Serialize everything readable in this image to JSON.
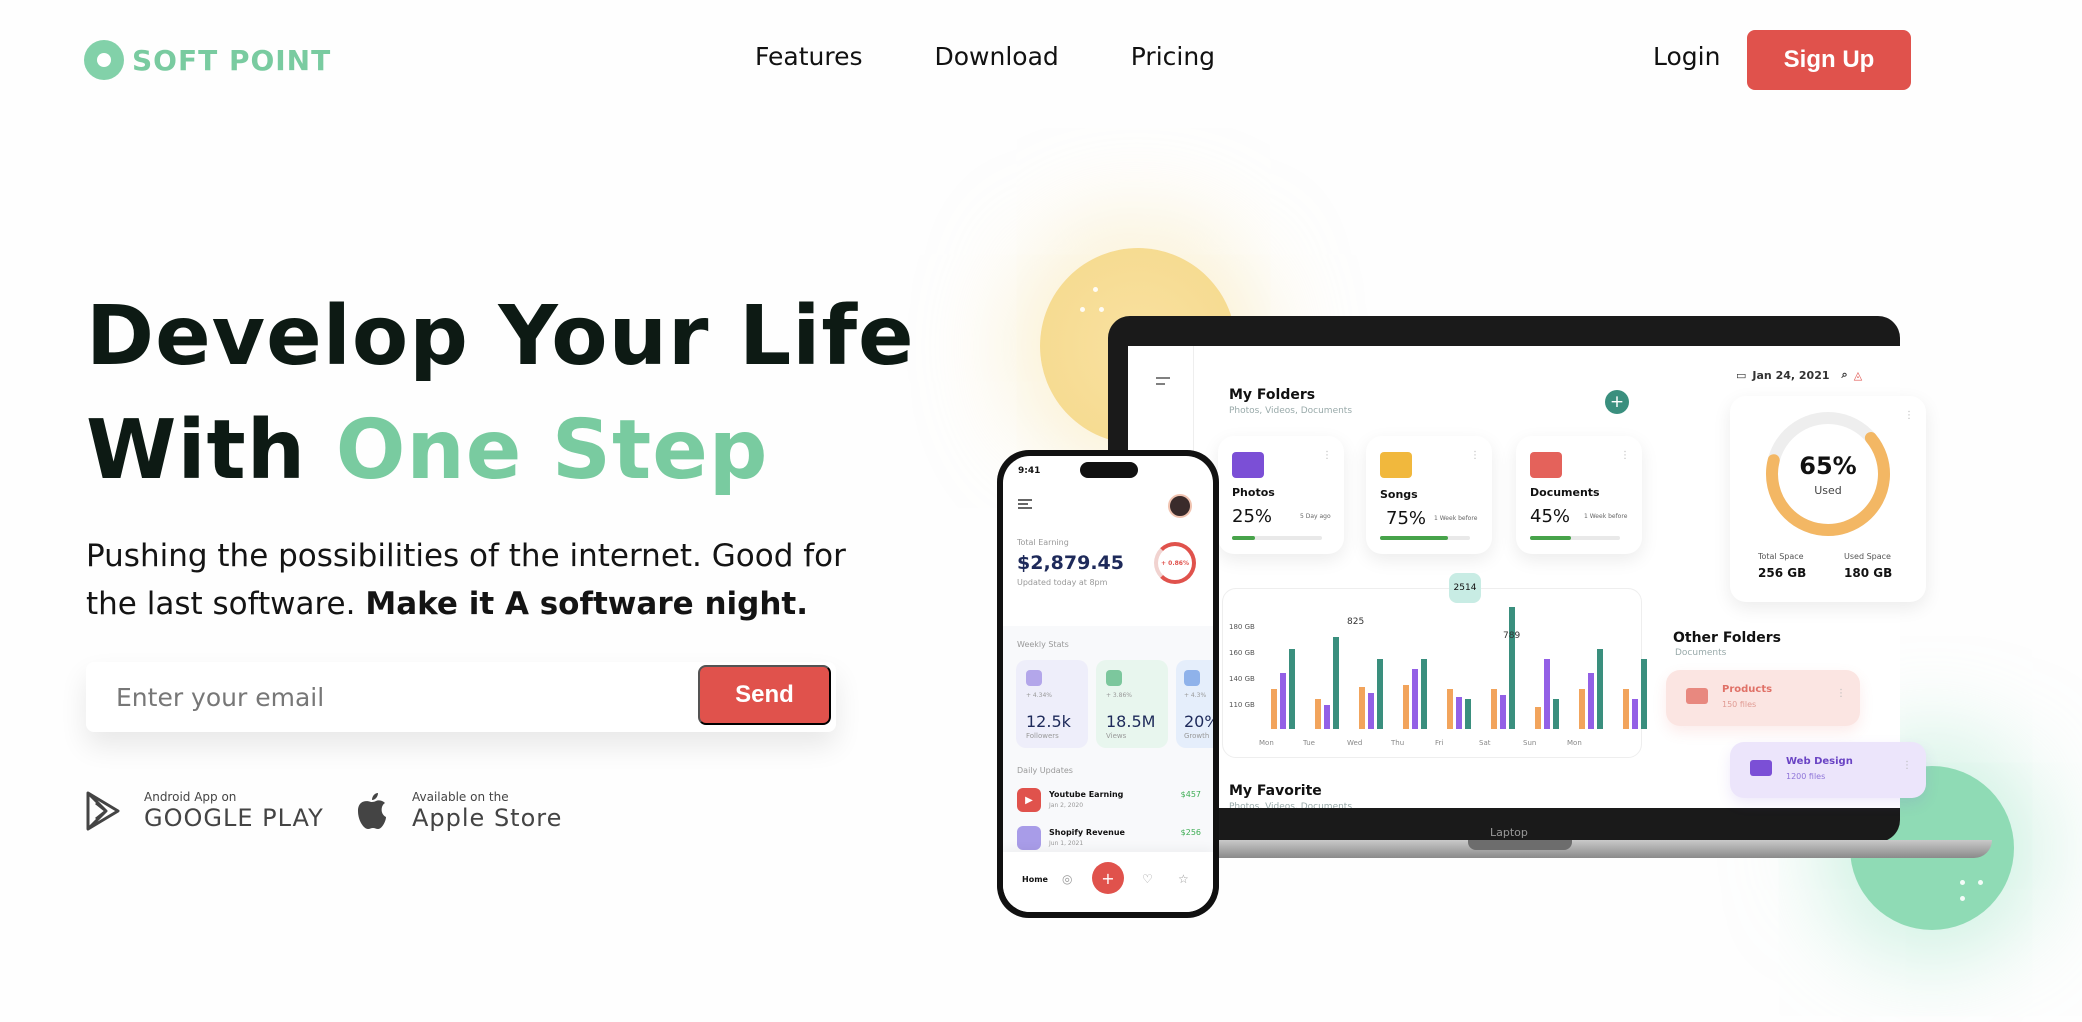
{
  "header": {
    "logo_text": "SOFT POINT",
    "nav": [
      "Features",
      "Download",
      "Pricing"
    ],
    "login_label": "Login",
    "signup_label": "Sign Up"
  },
  "hero": {
    "title_line1": "Develop Your Life",
    "title_line2_plain": "With ",
    "title_line2_accent": "One Step",
    "subtitle_plain": "Pushing the possibilities of the internet. Good for the last software. ",
    "subtitle_bold": "Make it A software night.",
    "email_placeholder": "Enter your email",
    "send_label": "Send"
  },
  "stores": {
    "google": {
      "small": "Android App on",
      "big": "GOOGLE PLAY"
    },
    "apple": {
      "small": "Available on the",
      "big": "Apple Store"
    }
  },
  "laptop": {
    "label": "Laptop",
    "date": "Jan 24, 2021",
    "folders_title": "My Folders",
    "folders_sub": "Photos, Videos, Documents",
    "folders": [
      {
        "name": "Photos",
        "percent": "25%",
        "meta": "5 Day ago",
        "fill": 0.25,
        "color": "#7b4fd6"
      },
      {
        "name": "Songs",
        "percent": "75%",
        "meta": "1 Week before",
        "fill": 0.75,
        "color": "#f1b83d"
      },
      {
        "name": "Documents",
        "percent": "45%",
        "meta": "1 Week before",
        "fill": 0.45,
        "color": "#e4625b"
      }
    ],
    "storage": {
      "percent": "65%",
      "used_label": "Used",
      "total_label": "Total Space",
      "total_value": "256 GB",
      "used_label2": "Used Space",
      "used_value": "180 GB",
      "fill": 0.65
    },
    "chart": {
      "ylabels": [
        "180 GB",
        "160 GB",
        "140 GB",
        "110 GB"
      ],
      "days": [
        "Mon",
        "Tue",
        "Wed",
        "Thu",
        "Fri",
        "Sat",
        "Sun",
        "Mon"
      ],
      "callouts": [
        "825",
        "2514",
        "789"
      ]
    },
    "other_title": "Other Folders",
    "other_sub": "Documents",
    "other": [
      {
        "name": "Products",
        "files": "150 files"
      },
      {
        "name": "Web Design",
        "files": "1200 files"
      }
    ],
    "favorite_title": "My Favorite",
    "favorite_sub": "Photos, Videos, Documents"
  },
  "phone": {
    "time": "9:41",
    "earning_label": "Total Earning",
    "earning_value": "$2,879.45",
    "earning_updated": "Updated today at 8pm",
    "ring_label": "+ 0.86%",
    "weekly_title": "Weekly Stats",
    "stats": [
      {
        "delta": "+ 4.34%",
        "value": "12.5k",
        "label": "Followers"
      },
      {
        "delta": "+ 3.86%",
        "value": "18.5M",
        "label": "Views"
      },
      {
        "delta": "+ 4.3%",
        "value": "20%",
        "label": "Growth"
      }
    ],
    "updates_title": "Daily Updates",
    "updates": [
      {
        "name": "Youtube Earning",
        "date": "Jan 2, 2020",
        "amount": "$457"
      },
      {
        "name": "Shopify Revenue",
        "date": "Jun 1, 2021",
        "amount": "$256"
      }
    ],
    "tab_home": "Home"
  },
  "colors": {
    "accent_green": "#79cba0",
    "brand_red": "#e0524c"
  },
  "icons": [
    "google-play-icon",
    "apple-icon",
    "plus-icon",
    "search-icon",
    "bell-icon",
    "calendar-icon",
    "menu-icon",
    "folder-icon",
    "more-icon"
  ]
}
